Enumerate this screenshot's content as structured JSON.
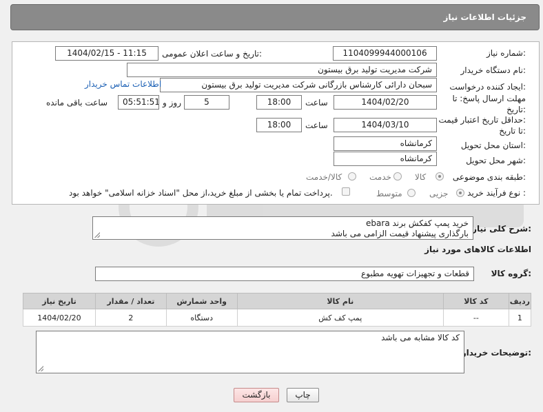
{
  "header": {
    "title": "جزئیات اطلاعات نیاز"
  },
  "form": {
    "need_number_label": "شماره نیاز:",
    "need_number": "1104099944000106",
    "announce_label": "تاریخ و ساعت اعلان عمومی:",
    "announce_value": "1404/02/15 - 11:15",
    "buyer_org_label": "نام دستگاه خریدار:",
    "buyer_org": "شرکت مدیریت تولید برق بیستون",
    "creator_label": "ایجاد کننده درخواست:",
    "creator": "سبحان دارائی کارشناس بازرگانی شرکت مدیریت تولید برق بیستون",
    "contact_link": "اطلاعات تماس خریدار",
    "deadline_label_1": "مهلت ارسال پاسخ: تا",
    "deadline_label_2": "تاریخ:",
    "deadline_date": "1404/02/20",
    "time_label": "ساعت",
    "deadline_time": "18:00",
    "days_value": "5",
    "days_label": "روز و",
    "remaining_time": "05:51:51",
    "remaining_label": "ساعت باقی مانده",
    "validity_label_1": "حداقل تاریخ اعتبار قیمت:",
    "validity_label_2": "تا تاریخ:",
    "validity_date": "1404/03/10",
    "validity_time": "18:00",
    "province_label": "استان محل تحویل:",
    "province": "کرمانشاه",
    "city_label": "شهر محل تحویل:",
    "city": "کرمانشاه",
    "category_label": "طبقه بندی موضوعی:",
    "category_options": [
      "کالا",
      "خدمت",
      "کالا/خدمت"
    ],
    "process_label": "نوع فرآیند خرید :",
    "process_options": [
      "جزیی",
      "متوسط"
    ],
    "payment_note": "پرداخت تمام یا بخشی از مبلغ خرید،از محل \"اسناد خزانه اسلامی\" خواهد بود."
  },
  "description": {
    "label": "شرح کلی نیاز:",
    "line1": "خرید پمپ کفکش برند ebara",
    "line2": "بارگذاری پیشنهاد قیمت الزامی می باشد"
  },
  "goods": {
    "section_title": "اطلاعات کالاهای مورد نیاز",
    "group_label": "گروه کالا:",
    "group_value": "قطعات و تجهیزات تهویه مطبوع",
    "columns": [
      "ردیف",
      "کد کالا",
      "نام کالا",
      "واحد شمارش",
      "تعداد / مقدار",
      "تاریخ نیاز"
    ],
    "rows": [
      [
        "1",
        "--",
        "پمپ کف کش",
        "دستگاه",
        "2",
        "1404/02/20"
      ]
    ]
  },
  "buyer_notes": {
    "label": "توضیحات خریدار:",
    "text": "کد کالا مشابه می باشد"
  },
  "buttons": {
    "print": "چاپ",
    "back": "بازگشت"
  },
  "colors": {
    "titlebar": "#8a8a8a",
    "link": "#1a5fb4",
    "back_button": "#f6cfcf"
  }
}
